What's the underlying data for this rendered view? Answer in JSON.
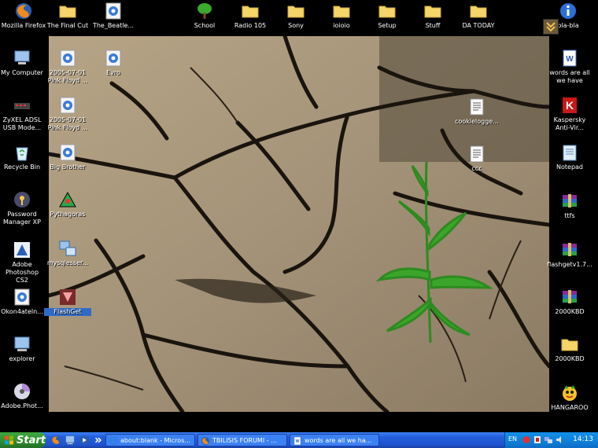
{
  "desktop": {
    "top_icons": [
      {
        "label": "Mozilla Firefox",
        "icon": "firefox-icon"
      },
      {
        "label": "The Final Cut",
        "icon": "folder-icon"
      },
      {
        "label": "The_Beatle...",
        "icon": "media-file-icon"
      },
      {
        "label": "School",
        "icon": "tree-icon"
      },
      {
        "label": "Radio 105",
        "icon": "folder-icon"
      },
      {
        "label": "Sony",
        "icon": "folder-icon"
      },
      {
        "label": "ioioio",
        "icon": "folder-icon"
      },
      {
        "label": "Setup",
        "icon": "folder-icon"
      },
      {
        "label": "Stuff",
        "icon": "folder-icon"
      },
      {
        "label": "DA TODAY",
        "icon": "folder-icon"
      },
      {
        "label": "bla-bla",
        "icon": "info-icon"
      }
    ],
    "left_icons": [
      {
        "label": "My Computer",
        "icon": "my-computer-icon"
      },
      {
        "label": "ZyXEL ADSL USB Mode...",
        "icon": "modem-icon"
      },
      {
        "label": "Recycle Bin",
        "icon": "recycle-bin-icon"
      },
      {
        "label": "Password Manager XP",
        "icon": "password-manager-icon"
      },
      {
        "label": "Adobe Photoshop CS2",
        "icon": "photoshop-icon"
      },
      {
        "label": "Okon4ateln...",
        "icon": "media-file-icon"
      },
      {
        "label": "explorer",
        "icon": "explorer-icon"
      },
      {
        "label": "Adobe.Phot...",
        "icon": "cd-icon"
      }
    ],
    "inner_icons": [
      {
        "label": "2005-07-01 Pink Floyd ...",
        "icon": "media-file-icon"
      },
      {
        "label": "Evro",
        "icon": "media-file-icon"
      },
      {
        "label": "2005-07-01 Pink Floyd ...",
        "icon": "media-file-icon"
      },
      {
        "label": "Big Brother",
        "icon": "media-file-icon"
      },
      {
        "label": "Pythagoras",
        "icon": "triangle-icon"
      },
      {
        "label": "mysqlesser...",
        "icon": "network-icon"
      },
      {
        "label": "FlashGet",
        "icon": "flashget-icon"
      },
      {
        "label": "cookielogge...",
        "icon": "text-file-icon"
      },
      {
        "label": "ccc",
        "icon": "text-file-icon"
      }
    ],
    "right_icons": [
      {
        "label": "words are all we have",
        "icon": "word-doc-icon"
      },
      {
        "label": "Kaspersky Anti-Vir...",
        "icon": "kaspersky-icon"
      },
      {
        "label": "Notepad",
        "icon": "notepad-icon"
      },
      {
        "label": "ttfs",
        "icon": "winrar-icon"
      },
      {
        "label": "flashgetv1.7...",
        "icon": "winrar-icon"
      },
      {
        "label": "2000KBD",
        "icon": "winrar-icon"
      },
      {
        "label": "2000KBD",
        "icon": "folder-icon"
      },
      {
        "label": "HANGAROO",
        "icon": "hangaroo-icon"
      }
    ]
  },
  "taskbar": {
    "start_label": "Start",
    "quick_launch": [
      "firefox-icon",
      "explorer-icon",
      "media-player-icon",
      "overflow-chevron-icon"
    ],
    "tasks": [
      {
        "label": "about:blank - Micros...",
        "icon": "ie-icon"
      },
      {
        "label": "TBILISIS FORUMI - ...",
        "icon": "firefox-icon"
      },
      {
        "label": "words are all we ha...",
        "icon": "word-doc-icon"
      }
    ],
    "tray": {
      "language": "EN",
      "clock": "14:13"
    }
  },
  "colors": {
    "taskbar": "#245edc",
    "start": "#2f8b2f",
    "tray": "#0f7fd8",
    "selection": "#316ac5"
  }
}
